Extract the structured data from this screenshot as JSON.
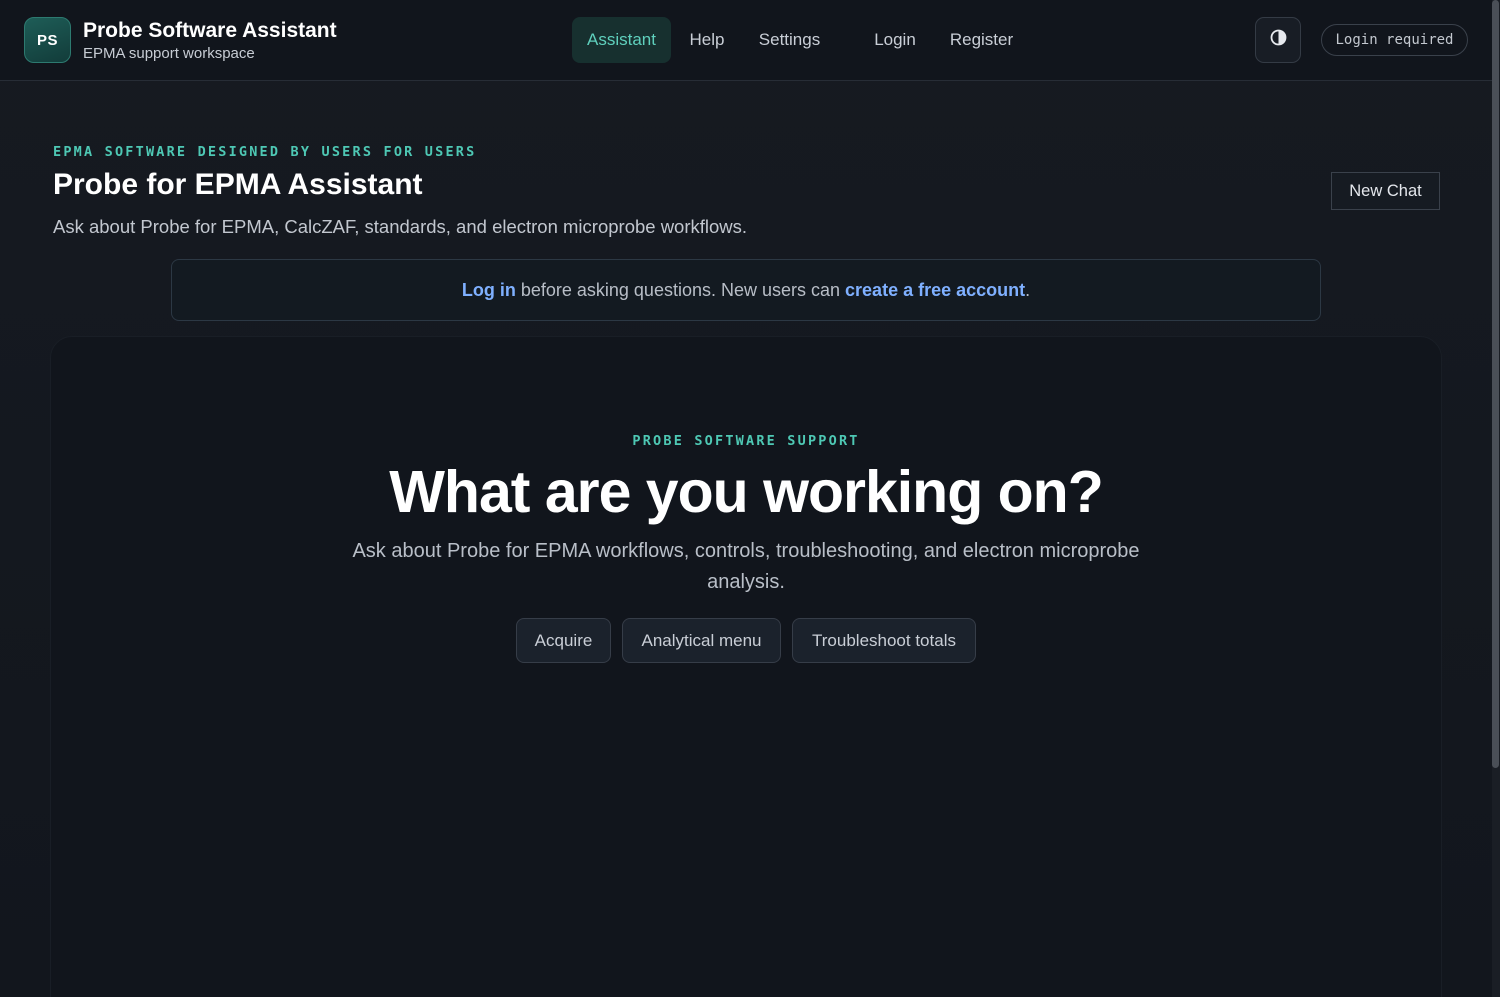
{
  "brand": {
    "logo_text": "PS",
    "title": "Probe Software Assistant",
    "subtitle": "EPMA support workspace"
  },
  "nav": {
    "items": [
      {
        "label": "Assistant",
        "active": true
      },
      {
        "label": "Help",
        "active": false
      },
      {
        "label": "Settings",
        "active": false
      },
      {
        "label": "Login",
        "active": false
      },
      {
        "label": "Register",
        "active": false
      }
    ]
  },
  "header_right": {
    "theme_icon": "half-circle-contrast-icon",
    "login_status": "Login required"
  },
  "intro": {
    "eyebrow": "EPMA SOFTWARE DESIGNED BY USERS FOR USERS",
    "title": "Probe for EPMA Assistant",
    "description": "Ask about Probe for EPMA, CalcZAF, standards, and electron microprobe workflows.",
    "new_chat_label": "New Chat"
  },
  "notice": {
    "login_link": "Log in",
    "middle_text": " before asking questions. New users can ",
    "register_link": "create a free account",
    "end_text": "."
  },
  "chat": {
    "eyebrow": "PROBE SOFTWARE SUPPORT",
    "heading": "What are you working on?",
    "description": "Ask about Probe for EPMA workflows, controls, troubleshooting, and electron microprobe analysis.",
    "suggestions": [
      "Acquire",
      "Analytical menu",
      "Troubleshoot totals"
    ]
  },
  "colors": {
    "accent": "#4ec8b4",
    "link": "#7fb0ff",
    "background": "#14181f"
  }
}
